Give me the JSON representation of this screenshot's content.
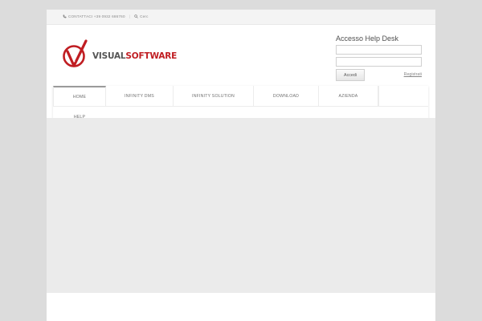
{
  "topbar": {
    "contact_label": "CONTATTACI +39 0932 686760",
    "separator": "|",
    "search_label": "Cerc"
  },
  "logo": {
    "word1": "VISUAL",
    "word2": "SOFTWARE",
    "brand_red": "#c01d22",
    "brand_gray": "#555555"
  },
  "login": {
    "title": "Accesso Help Desk",
    "username_value": "",
    "password_value": "",
    "submit_label": "Accedi",
    "register_label": "Registrati"
  },
  "nav": {
    "items": [
      {
        "label": "HOME",
        "active": true
      },
      {
        "label": "INFINITY DMS"
      },
      {
        "label": "INFINITY SOLUTION"
      },
      {
        "label": "DOWNLOAD"
      },
      {
        "label": "AZIENDA"
      },
      {
        "label": ""
      },
      {
        "label": "HELP"
      }
    ]
  },
  "icons": [
    "phone-icon",
    "search-icon",
    "logo-mark-icon"
  ]
}
